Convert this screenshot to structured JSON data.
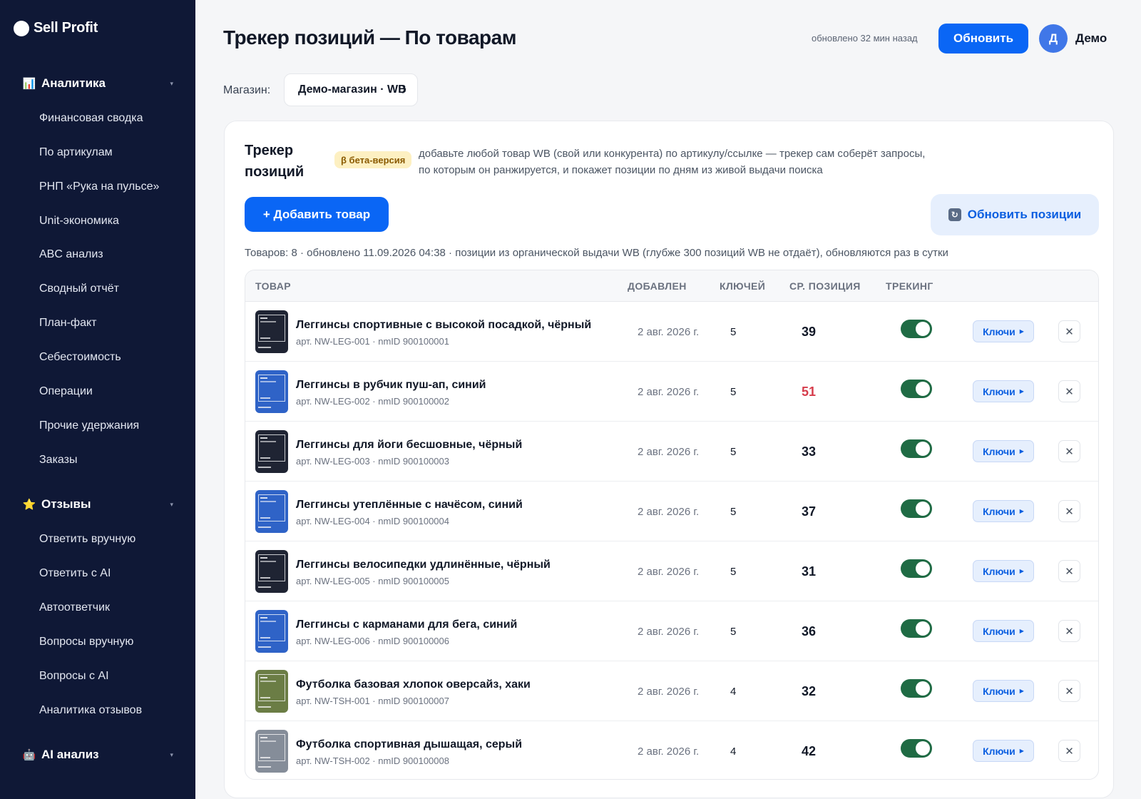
{
  "brand": {
    "name": "Sell Profit"
  },
  "sidebar": {
    "sections": [
      {
        "label": "Аналитика",
        "icon": "chart-icon",
        "glyph": "📊"
      },
      {
        "label": "Отзывы",
        "icon": "star-icon",
        "glyph": "⭐"
      },
      {
        "label": "AI анализ",
        "icon": "robot-icon",
        "glyph": "🤖"
      }
    ],
    "analytics_items": [
      "Финансовая сводка",
      "По артикулам",
      "РНП «Рука на пульсе»",
      "Unit-экономика",
      "ABC анализ",
      "Сводный отчёт",
      "План-факт",
      "Себестоимость",
      "Операции",
      "Прочие удержания",
      "Заказы"
    ],
    "reviews_items": [
      "Ответить вручную",
      "Ответить с AI",
      "Автоответчик",
      "Вопросы вручную",
      "Вопросы с AI",
      "Аналитика отзывов"
    ]
  },
  "header": {
    "title": "Трекер позиций — По товарам",
    "updated": "обновлено 32 мин назад",
    "refresh_label": "Обновить",
    "avatar_letter": "Д",
    "user_name": "Демо"
  },
  "store": {
    "label": "Магазин:",
    "value": "Демо-магазин · WB"
  },
  "tracker": {
    "title": "Трекер позиций",
    "badge": "β бета-версия",
    "description": "добавьте любой товар WB (свой или конкурента) по артикулу/ссылке — трекер сам соберёт запросы, по которым он ранжируется, и покажет позиции по дням из живой выдачи поиска",
    "add_label": "+ Добавить товар",
    "refresh_positions_label": "Обновить позиции",
    "summary": "Товаров: 8 · обновлено 11.09.2026 04:38 · позиции из органической выдачи WB (глубже 300 позиций WB не отдаёт), обновляются раз в сутки"
  },
  "table": {
    "columns": [
      "ТОВАР",
      "ДОБАВЛЕН",
      "КЛЮЧЕЙ",
      "СР. ПОЗИЦИЯ",
      "ТРЕКИНГ"
    ],
    "keys_label": "Ключи",
    "delete_glyph": "✕",
    "rows": [
      {
        "name": "Леггинсы спортивные с высокой посадкой, чёрный",
        "sku": "арт. NW-LEG-001 · nmID 900100001",
        "added": "2 авг. 2026 г.",
        "keys": "5",
        "position": "39",
        "highlight": false,
        "tracking": true,
        "thumb_color": "#1f2433"
      },
      {
        "name": "Леггинсы в рубчик пуш-ап, синий",
        "sku": "арт. NW-LEG-002 · nmID 900100002",
        "added": "2 авг. 2026 г.",
        "keys": "5",
        "position": "51",
        "highlight": true,
        "tracking": true,
        "thumb_color": "#2f63c7"
      },
      {
        "name": "Леггинсы для йоги бесшовные, чёрный",
        "sku": "арт. NW-LEG-003 · nmID 900100003",
        "added": "2 авг. 2026 г.",
        "keys": "5",
        "position": "33",
        "highlight": false,
        "tracking": true,
        "thumb_color": "#1f2433"
      },
      {
        "name": "Леггинсы утеплённые с начёсом, синий",
        "sku": "арт. NW-LEG-004 · nmID 900100004",
        "added": "2 авг. 2026 г.",
        "keys": "5",
        "position": "37",
        "highlight": false,
        "tracking": true,
        "thumb_color": "#2f63c7"
      },
      {
        "name": "Леггинсы велосипедки удлинённые, чёрный",
        "sku": "арт. NW-LEG-005 · nmID 900100005",
        "added": "2 авг. 2026 г.",
        "keys": "5",
        "position": "31",
        "highlight": false,
        "tracking": true,
        "thumb_color": "#1f2433"
      },
      {
        "name": "Леггинсы с карманами для бега, синий",
        "sku": "арт. NW-LEG-006 · nmID 900100006",
        "added": "2 авг. 2026 г.",
        "keys": "5",
        "position": "36",
        "highlight": false,
        "tracking": true,
        "thumb_color": "#2f63c7"
      },
      {
        "name": "Футболка базовая хлопок оверсайз, хаки",
        "sku": "арт. NW-TSH-001 · nmID 900100007",
        "added": "2 авг. 2026 г.",
        "keys": "4",
        "position": "32",
        "highlight": false,
        "tracking": true,
        "thumb_color": "#6b7d45"
      },
      {
        "name": "Футболка спортивная дышащая, серый",
        "sku": "арт. NW-TSH-002 · nmID 900100008",
        "added": "2 авг. 2026 г.",
        "keys": "4",
        "position": "42",
        "highlight": false,
        "tracking": true,
        "thumb_color": "#858d99"
      }
    ]
  },
  "colors": {
    "accent": "#0a66f5",
    "sidebar_bg": "#0f1836",
    "toggle_on": "#1f6b44",
    "warn": "#d63c4b"
  }
}
